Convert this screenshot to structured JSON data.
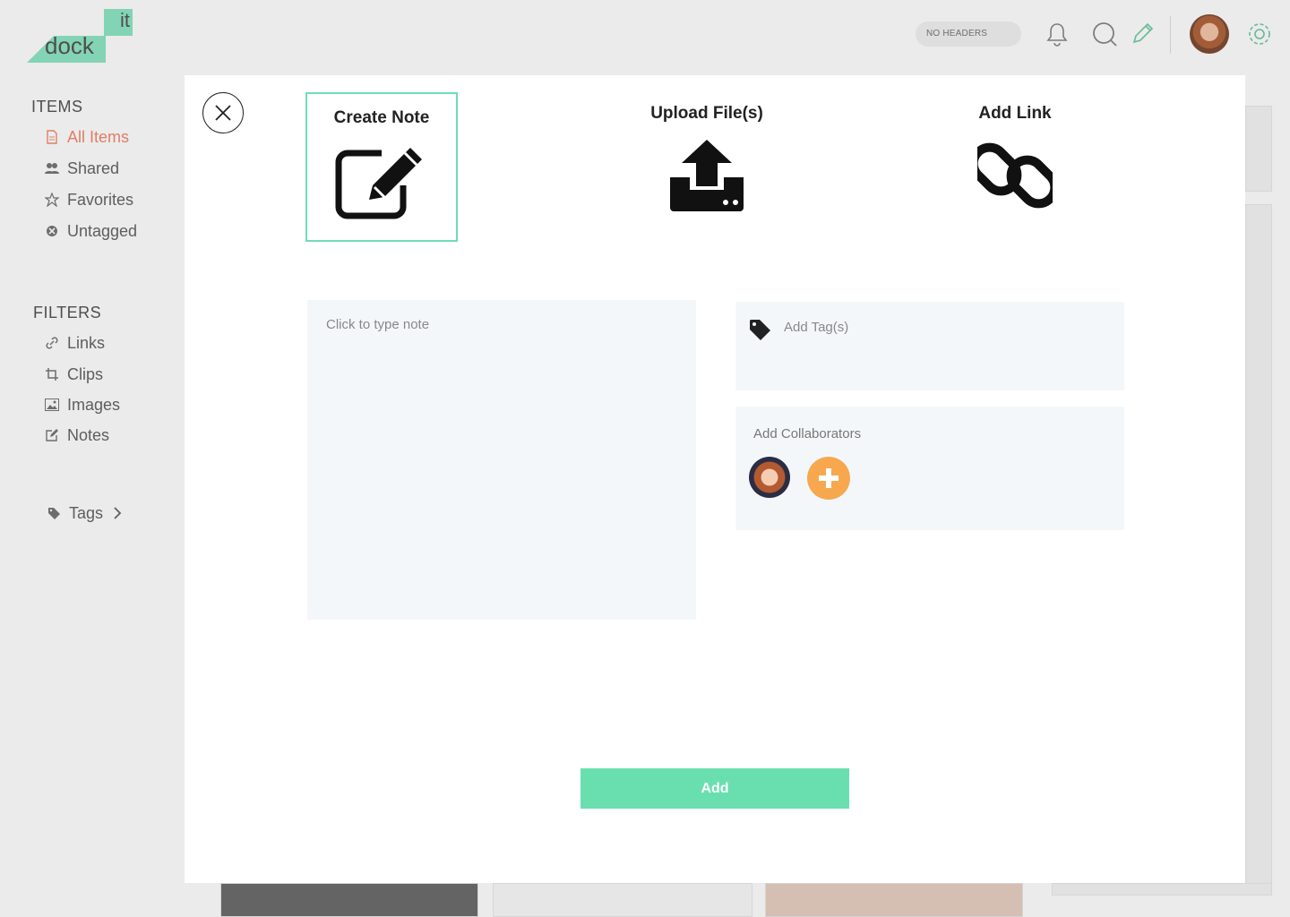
{
  "logo": {
    "part_top": "it",
    "part_bottom": "dock"
  },
  "header": {
    "toggle_label": "NO HEADERS",
    "icons": [
      "bell-icon",
      "search-icon",
      "pencil-icon",
      "avatar",
      "gear-icon"
    ]
  },
  "sidebar": {
    "items_title": "ITEMS",
    "items": [
      {
        "label": "All Items",
        "icon": "document-icon",
        "active": true
      },
      {
        "label": "Shared",
        "icon": "users-icon"
      },
      {
        "label": "Favorites",
        "icon": "star-icon"
      },
      {
        "label": "Untagged",
        "icon": "untagged-icon"
      }
    ],
    "filters_title": "FILTERS",
    "filters": [
      {
        "label": "Links",
        "icon": "link-icon"
      },
      {
        "label": "Clips",
        "icon": "crop-icon"
      },
      {
        "label": "Images",
        "icon": "image-icon"
      },
      {
        "label": "Notes",
        "icon": "edit-icon"
      }
    ],
    "tags_label": "Tags"
  },
  "modal": {
    "options": [
      {
        "label": "Create Note",
        "icon": "edit-note-icon",
        "selected": true
      },
      {
        "label": "Upload File(s)",
        "icon": "upload-icon",
        "selected": false
      },
      {
        "label": "Add Link",
        "icon": "chain-link-icon",
        "selected": false
      }
    ],
    "note_placeholder": "Click to type note",
    "tags_placeholder": "Add Tag(s)",
    "collaborators_title": "Add Collaborators",
    "add_button": "Add"
  },
  "colors": {
    "accent": "#69dfb0",
    "selected_border": "#6fddb6",
    "active_sidebar": "#f38a70",
    "add_collaborator": "#f7a84f",
    "field_bg": "#f4f7fa"
  }
}
